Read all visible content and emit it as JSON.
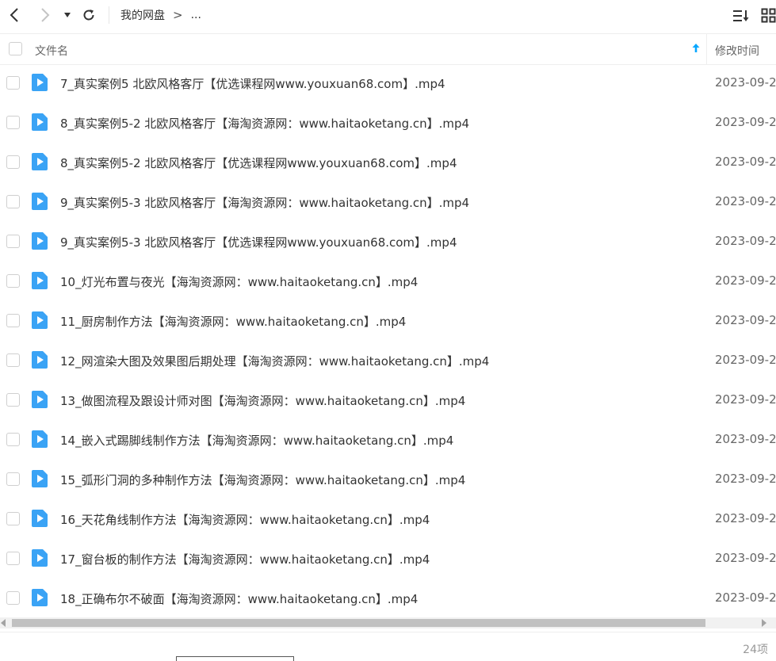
{
  "toolbar": {
    "back_icon": "chevron-left-icon",
    "forward_icon": "chevron-right-icon",
    "dropdown_icon": "caret-down-icon",
    "refresh_icon": "refresh-icon",
    "breadcrumb": [
      "我的网盘",
      "..."
    ],
    "breadcrumb_separator": ">",
    "sort_icon": "sort-list-icon",
    "view_icon": "grid-view-icon"
  },
  "header": {
    "name_label": "文件名",
    "date_label": "修改时间",
    "sort_icon": "arrow-up-icon",
    "accent_color": "#06a7ff"
  },
  "files": [
    {
      "name": "7_真实案例5 北欧风格客厅【优选课程网www.youxuan68.com】.mp4",
      "date": "2023-09-2"
    },
    {
      "name": "8_真实案例5-2 北欧风格客厅【海淘资源网：www.haitaoketang.cn】.mp4",
      "date": "2023-09-2"
    },
    {
      "name": "8_真实案例5-2 北欧风格客厅【优选课程网www.youxuan68.com】.mp4",
      "date": "2023-09-2"
    },
    {
      "name": "9_真实案例5-3 北欧风格客厅【海淘资源网：www.haitaoketang.cn】.mp4",
      "date": "2023-09-2"
    },
    {
      "name": "9_真实案例5-3 北欧风格客厅【优选课程网www.youxuan68.com】.mp4",
      "date": "2023-09-2"
    },
    {
      "name": "10_灯光布置与夜光【海淘资源网：www.haitaoketang.cn】.mp4",
      "date": "2023-09-2"
    },
    {
      "name": "11_厨房制作方法【海淘资源网：www.haitaoketang.cn】.mp4",
      "date": "2023-09-2"
    },
    {
      "name": "12_网渲染大图及效果图后期处理【海淘资源网：www.haitaoketang.cn】.mp4",
      "date": "2023-09-2"
    },
    {
      "name": "13_做图流程及跟设计师对图【海淘资源网：www.haitaoketang.cn】.mp4",
      "date": "2023-09-2"
    },
    {
      "name": "14_嵌入式踢脚线制作方法【海淘资源网：www.haitaoketang.cn】.mp4",
      "date": "2023-09-2"
    },
    {
      "name": "15_弧形门洞的多种制作方法【海淘资源网：www.haitaoketang.cn】.mp4",
      "date": "2023-09-2"
    },
    {
      "name": "16_天花角线制作方法【海淘资源网：www.haitaoketang.cn】.mp4",
      "date": "2023-09-2"
    },
    {
      "name": "17_窗台板的制作方法【海淘资源网：www.haitaoketang.cn】.mp4",
      "date": "2023-09-2"
    },
    {
      "name": "18_正确布尔不破面【海淘资源网：www.haitaoketang.cn】.mp4",
      "date": "2023-09-2"
    }
  ],
  "file_icon": "video-play-icon",
  "file_icon_color": "#3aa3f5",
  "footer": {
    "count": "24项"
  }
}
